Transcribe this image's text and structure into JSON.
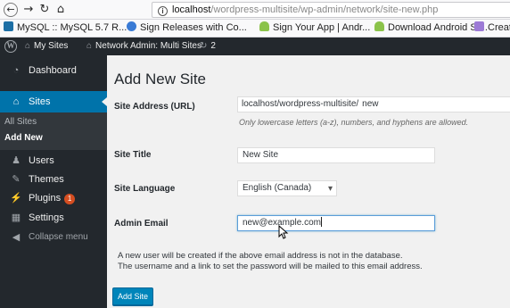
{
  "browser": {
    "url_host": "localhost",
    "url_path": "/wordpress-multisite/wp-admin/network/site-new.php"
  },
  "bookmarks": [
    {
      "label": "MySQL :: MySQL 5.7 R...",
      "icon": "mysql-icon",
      "color": "#1d6fa5"
    },
    {
      "label": "Sign Releases with Co...",
      "icon": "globe-icon",
      "color": "#3a7bd5"
    },
    {
      "label": "Sign Your App | Andr...",
      "icon": "android-icon",
      "color": "#8bc34a"
    },
    {
      "label": "Download Android St...",
      "icon": "android-icon",
      "color": "#8bc34a"
    },
    {
      "label": "Creating C",
      "icon": "paint-icon",
      "color": "#9c7ad6"
    }
  ],
  "adminbar": {
    "my_sites": "My Sites",
    "network_admin": "Network Admin: Multi Sites",
    "updates_count": "2"
  },
  "sidebar": {
    "dashboard": "Dashboard",
    "sites": "Sites",
    "all_sites": "All Sites",
    "add_new": "Add New",
    "users": "Users",
    "themes": "Themes",
    "plugins": "Plugins",
    "plugins_badge": "1",
    "settings": "Settings",
    "collapse": "Collapse menu"
  },
  "form": {
    "title": "Add New Site",
    "site_address_label": "Site Address (URL)",
    "site_address_prefix": "localhost/wordpress-multisite/",
    "site_address_value": "new",
    "site_address_hint": "Only lowercase letters (a-z), numbers, and hyphens are allowed.",
    "site_title_label": "Site Title",
    "site_title_value": "New Site",
    "site_language_label": "Site Language",
    "site_language_value": "English (Canada)",
    "admin_email_label": "Admin Email",
    "admin_email_value": "new@example.com",
    "note_line1": "A new user will be created if the above email address is not in the database.",
    "note_line2": "The username and a link to set the password will be mailed to this email address.",
    "submit_label": "Add Site"
  },
  "colors": {
    "accent": "#0073aa",
    "button": "#0085ba",
    "sidebar_bg": "#23282d",
    "badge": "#d54e21"
  }
}
